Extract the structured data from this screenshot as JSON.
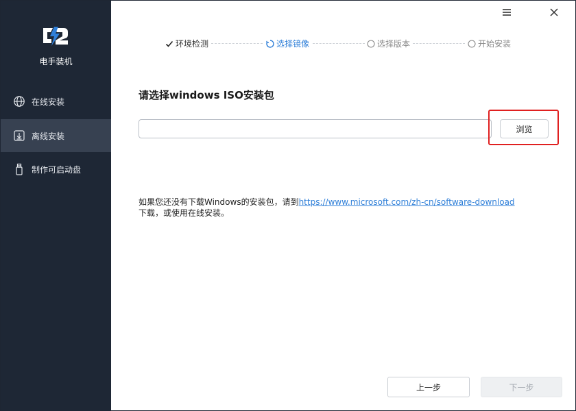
{
  "app": {
    "name": "电手装机"
  },
  "sidebar": {
    "items": [
      {
        "label": "在线安装",
        "icon": "globe-icon",
        "active": false
      },
      {
        "label": "离线安装",
        "icon": "download-box-icon",
        "active": true
      },
      {
        "label": "制作可启动盘",
        "icon": "usb-drive-icon",
        "active": false
      }
    ]
  },
  "window_controls": {
    "menu_icon": "hamburger-menu-icon",
    "close_icon": "close-icon"
  },
  "stepper": {
    "steps": [
      {
        "label": "环境检测",
        "state": "done"
      },
      {
        "label": "选择镜像",
        "state": "current"
      },
      {
        "label": "选择版本",
        "state": "todo"
      },
      {
        "label": "开始安装",
        "state": "todo"
      }
    ]
  },
  "main": {
    "title": "请选择windows ISO安装包",
    "path_input": {
      "value": "",
      "placeholder": ""
    },
    "browse_label": "浏览",
    "note_prefix": "如果您还没有下载Windows的安装包，请到",
    "note_link": "https://www.microsoft.com/zh-cn/software-download",
    "note_suffix": "下载，或使用在线安装。"
  },
  "footer": {
    "prev_label": "上一步",
    "next_label": "下一步"
  },
  "colors": {
    "sidebar_bg": "#1e2735",
    "sidebar_active": "#374151",
    "accent": "#2f7fd8",
    "highlight": "#e02020"
  }
}
